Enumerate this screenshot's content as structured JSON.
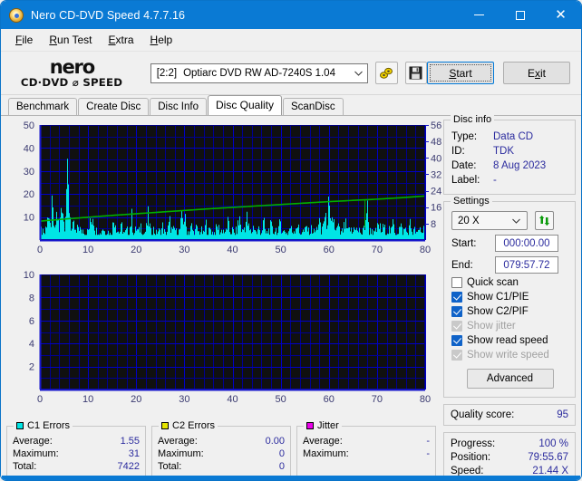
{
  "window": {
    "title": "Nero CD-DVD Speed 4.7.7.16",
    "icon": "nero-disc-icon",
    "controls": {
      "minimize": "–",
      "maximize": "□",
      "close": "✕"
    }
  },
  "menu": {
    "items": [
      "File",
      "Run Test",
      "Extra",
      "Help"
    ]
  },
  "toolbar": {
    "logo_top": "nero",
    "logo_bottom": "CD·DVD ⌀ SPEED",
    "drive_index": "[2:2]",
    "drive_name": "Optiarc DVD RW AD-7240S 1.04",
    "eject_icon": "eject-disc-icon",
    "save_icon": "floppy-save-icon",
    "start_label": "Start",
    "exit_label": "Exit"
  },
  "tabs": {
    "items": [
      "Benchmark",
      "Create Disc",
      "Disc Info",
      "Disc Quality",
      "ScanDisc"
    ],
    "active": "Disc Quality"
  },
  "disc_info": {
    "title": "Disc info",
    "rows": [
      {
        "label": "Type:",
        "value": "Data CD"
      },
      {
        "label": "ID:",
        "value": "TDK"
      },
      {
        "label": "Date:",
        "value": "8 Aug 2023"
      },
      {
        "label": "Label:",
        "value": "-"
      }
    ]
  },
  "settings": {
    "title": "Settings",
    "speed": "20 X",
    "refresh_icon": "refresh-arrows-icon",
    "start_label": "Start:",
    "start_value": "000:00.00",
    "end_label": "End:",
    "end_value": "079:57.72",
    "checkboxes": [
      {
        "label": "Quick scan",
        "checked": false,
        "enabled": true
      },
      {
        "label": "Show C1/PIE",
        "checked": true,
        "enabled": true
      },
      {
        "label": "Show C2/PIF",
        "checked": true,
        "enabled": true
      },
      {
        "label": "Show jitter",
        "checked": true,
        "enabled": false
      },
      {
        "label": "Show read speed",
        "checked": true,
        "enabled": true
      },
      {
        "label": "Show write speed",
        "checked": true,
        "enabled": false
      }
    ],
    "advanced_label": "Advanced"
  },
  "quality": {
    "label": "Quality score:",
    "value": "95"
  },
  "status": {
    "rows": [
      {
        "label": "Progress:",
        "value": "100 %"
      },
      {
        "label": "Position:",
        "value": "79:55.67"
      },
      {
        "label": "Speed:",
        "value": "21.44 X"
      }
    ]
  },
  "legend": {
    "c1": {
      "title": "C1 Errors",
      "color": "#00e5e5",
      "rows": [
        {
          "label": "Average:",
          "value": "1.55"
        },
        {
          "label": "Maximum:",
          "value": "31"
        },
        {
          "label": "Total:",
          "value": "7422"
        }
      ]
    },
    "c2": {
      "title": "C2 Errors",
      "color": "#e5e500",
      "rows": [
        {
          "label": "Average:",
          "value": "0.00"
        },
        {
          "label": "Maximum:",
          "value": "0"
        },
        {
          "label": "Total:",
          "value": "0"
        }
      ]
    },
    "jitter": {
      "title": "Jitter",
      "color": "#ea00ea",
      "rows": [
        {
          "label": "Average:",
          "value": "-"
        },
        {
          "label": "Maximum:",
          "value": "-"
        }
      ]
    }
  },
  "chart_data": [
    {
      "type": "area",
      "name": "c1-errors-chart",
      "title": "C1/PIE errors vs disc position",
      "xlabel": "",
      "ylabel": "",
      "xlim": [
        0,
        80
      ],
      "ylim": [
        0,
        50
      ],
      "xticks": [
        0,
        10,
        20,
        30,
        40,
        50,
        60,
        70,
        80
      ],
      "yticks": [
        10,
        20,
        30,
        40,
        50
      ],
      "y2lim": [
        0,
        56
      ],
      "y2ticks": [
        8,
        16,
        24,
        32,
        40,
        48,
        56
      ],
      "grid": true,
      "background": "#101010",
      "gridcolor": "#0000c8",
      "series": [
        {
          "name": "C1 Errors",
          "color": "#00e5e5",
          "kind": "area",
          "x": [
            0,
            0.5,
            1,
            1.5,
            2,
            2.5,
            3,
            3.5,
            4,
            4.5,
            5,
            5.5,
            6,
            6.5,
            7,
            7.5,
            8,
            8.5,
            9,
            9.5,
            10,
            10.5,
            11,
            11.5,
            12,
            12.5,
            13,
            13.5,
            14,
            14.5,
            15,
            15.5,
            16,
            16.5,
            17,
            17.5,
            18,
            18.5,
            19,
            19.5,
            20,
            20.5,
            21,
            21.5,
            22,
            22.5,
            23,
            23.5,
            24,
            24.5,
            25,
            25.5,
            26,
            26.5,
            27,
            27.5,
            28,
            28.5,
            29,
            29.5,
            30,
            30.5,
            31,
            31.5,
            32,
            32.5,
            33,
            33.5,
            34,
            34.5,
            35,
            35.5,
            36,
            36.5,
            37,
            37.5,
            38,
            38.5,
            39,
            39.5,
            40,
            40.5,
            41,
            41.5,
            42,
            42.5,
            43,
            43.5,
            44,
            44.5,
            45,
            45.5,
            46,
            46.5,
            47,
            47.5,
            48,
            48.5,
            49,
            49.5,
            50,
            50.5,
            51,
            51.5,
            52,
            52.5,
            53,
            53.5,
            54,
            54.5,
            55,
            55.5,
            56,
            56.5,
            57,
            57.5,
            58,
            58.5,
            59,
            59.5,
            60,
            60.5,
            61,
            61.5,
            62,
            62.5,
            63,
            63.5,
            64,
            64.5,
            65,
            65.5,
            66,
            66.5,
            67,
            67.5,
            68,
            68.5,
            69,
            69.5,
            70,
            70.5,
            71,
            71.5,
            72,
            72.5,
            73,
            73.5,
            74,
            74.5,
            75,
            75.5,
            76,
            76.5,
            77,
            77.5,
            78,
            78.5,
            79,
            79.5,
            80
          ],
          "y": [
            4,
            6,
            3,
            15,
            5,
            16,
            4,
            15,
            3,
            26,
            6,
            31,
            20,
            5,
            7,
            3,
            8,
            4,
            6,
            3,
            5,
            9,
            15,
            4,
            6,
            3,
            7,
            4,
            5,
            3,
            6,
            13,
            5,
            4,
            7,
            3,
            5,
            4,
            12,
            3,
            6,
            4,
            8,
            3,
            5,
            12,
            4,
            6,
            3,
            5,
            4,
            7,
            3,
            5,
            9,
            4,
            6,
            3,
            5,
            11,
            12,
            5,
            4,
            7,
            3,
            6,
            4,
            5,
            3,
            8,
            4,
            6,
            3,
            5,
            7,
            4,
            6,
            3,
            9,
            4,
            5,
            3,
            6,
            11,
            4,
            7,
            11,
            5,
            4,
            8,
            3,
            6,
            4,
            9,
            3,
            5,
            7,
            4,
            6,
            3,
            10,
            4,
            5,
            3,
            7,
            4,
            6,
            9,
            3,
            5,
            4,
            7,
            3,
            6,
            4,
            5,
            11,
            3,
            12,
            9,
            16,
            6,
            12,
            4,
            7,
            3,
            5,
            8,
            4,
            6,
            3,
            9,
            4,
            5,
            3,
            7,
            18,
            4,
            6,
            3,
            5,
            8,
            4,
            7,
            3,
            6,
            4,
            9,
            3,
            5,
            7,
            4,
            6,
            3,
            8,
            4,
            5,
            3,
            6,
            4,
            7,
            3,
            5,
            4
          ]
        },
        {
          "name": "Read speed",
          "color": "#00b000",
          "kind": "line",
          "axis": "right",
          "x": [
            0,
            5,
            10,
            15,
            20,
            25,
            30,
            35,
            40,
            45,
            50,
            55,
            60,
            65,
            70,
            75,
            80
          ],
          "y": [
            9.2,
            10.2,
            11.1,
            12.0,
            12.8,
            13.6,
            14.4,
            15.2,
            15.9,
            16.6,
            17.3,
            18.0,
            18.7,
            19.3,
            19.9,
            20.6,
            21.44
          ]
        }
      ]
    },
    {
      "type": "area",
      "name": "c2-errors-chart",
      "title": "C2/PIF errors vs disc position",
      "xlabel": "",
      "ylabel": "",
      "xlim": [
        0,
        80
      ],
      "ylim": [
        0,
        10
      ],
      "xticks": [
        0,
        10,
        20,
        30,
        40,
        50,
        60,
        70,
        80
      ],
      "yticks": [
        2,
        4,
        6,
        8,
        10
      ],
      "grid": true,
      "background": "#101010",
      "gridcolor": "#0000c8",
      "series": [
        {
          "name": "C2 Errors",
          "color": "#e5e500",
          "kind": "area",
          "x": [
            0,
            80
          ],
          "y": [
            0,
            0
          ]
        }
      ]
    }
  ]
}
